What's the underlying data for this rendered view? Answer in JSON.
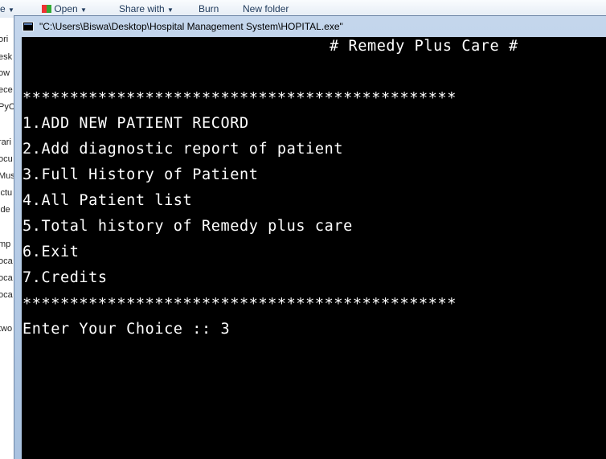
{
  "background_window": {
    "toolbar": {
      "organize": "e",
      "open": "Open",
      "share_with": "Share with",
      "burn": "Burn",
      "new_folder": "New folder"
    },
    "nav_items": [
      "ori",
      "esk",
      "ow",
      "ece",
      "PyC",
      "rari",
      "ocu",
      "Mus",
      "ictu",
      "ide",
      "mp",
      "oca",
      "oca",
      "oca",
      "two"
    ]
  },
  "console_window": {
    "title": "\"C:\\Users\\Biswa\\Desktop\\Hospital Management  System\\HOPITAL.exe\"",
    "lines": {
      "header": "# Remedy Plus Care #",
      "separator_top": "**********************************************",
      "menu": [
        "1.ADD NEW PATIENT RECORD",
        "2.Add diagnostic report of patient",
        "3.Full History of Patient",
        "4.All Patient list",
        "5.Total history of Remedy plus care",
        "6.Exit",
        "7.Credits"
      ],
      "separator_bottom": "**********************************************",
      "prompt": "Enter Your Choice :: 3"
    }
  },
  "colors": {
    "console_bg": "#000000",
    "console_fg": "#ffffff",
    "title_bar": "#b9cde6"
  }
}
